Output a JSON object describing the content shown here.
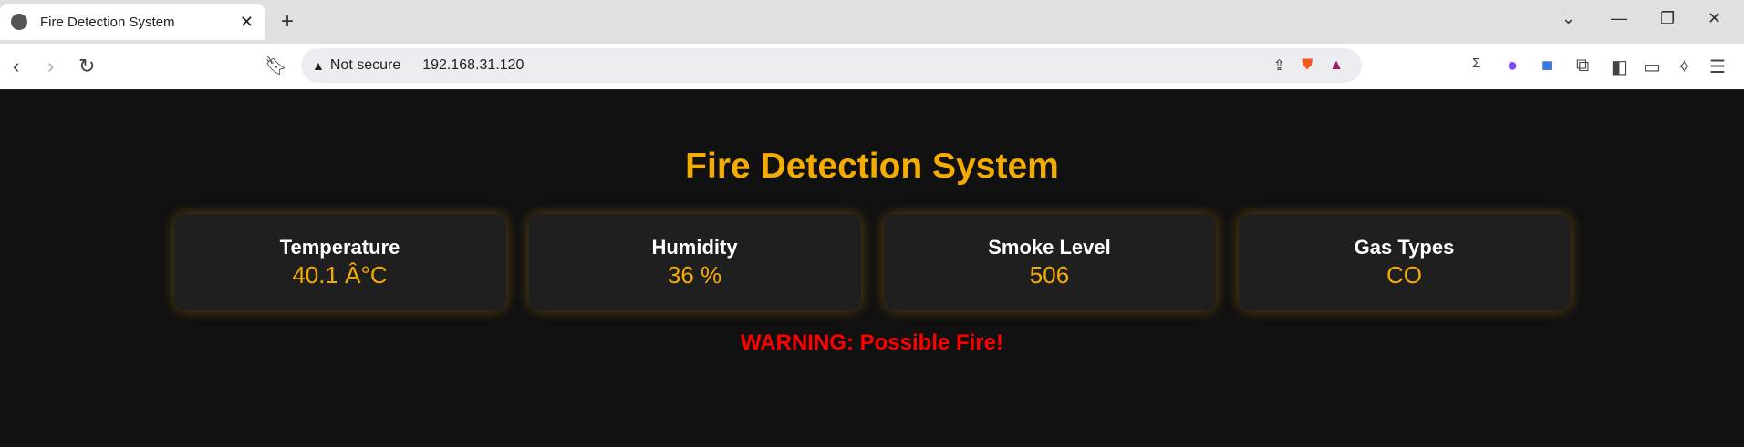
{
  "browser": {
    "tab_title": "Fire Detection System",
    "new_tab": "+",
    "security_label": "Not secure",
    "url": "192.168.31.120"
  },
  "page": {
    "title": "Fire Detection System",
    "cards": [
      {
        "label": "Temperature",
        "value": "40.1 Â°C"
      },
      {
        "label": "Humidity",
        "value": "36 %"
      },
      {
        "label": "Smoke Level",
        "value": "506"
      },
      {
        "label": "Gas Types",
        "value": "CO"
      }
    ],
    "warning": "WARNING: Possible Fire!"
  },
  "colors": {
    "accent": "#f5ac00",
    "warning": "#ff0000",
    "background": "#111111",
    "card": "#1f1f1f"
  }
}
